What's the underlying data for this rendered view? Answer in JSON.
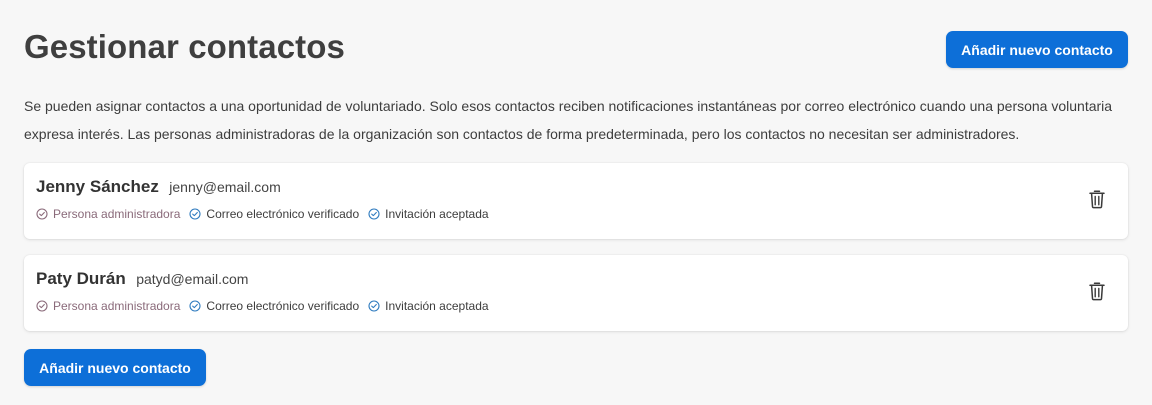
{
  "header": {
    "title": "Gestionar contactos",
    "add_button_label": "Añadir nuevo contacto"
  },
  "description": "Se pueden asignar contactos a una oportunidad de voluntariado. Solo esos contactos reciben notificaciones instantáneas por correo electrónico cuando una persona voluntaria expresa interés. Las personas administradoras de la organización son contactos de forma predeterminada, pero los contactos no necesitan ser administradores.",
  "contacts": [
    {
      "name": "Jenny Sánchez",
      "email": "jenny@email.com",
      "badges": [
        "Persona administradora",
        "Correo electrónico verificado",
        "Invitación aceptada"
      ]
    },
    {
      "name": "Paty Durán",
      "email": "patyd@email.com",
      "badges": [
        "Persona administradora",
        "Correo electrónico verificado",
        "Invitación aceptada"
      ]
    }
  ],
  "footer": {
    "add_button_label": "Añadir nuevo contacto"
  },
  "icons": {
    "badge": "check-circle-icon",
    "delete": "trash-icon"
  },
  "colors": {
    "primary": "#0d6fd8",
    "admin_badge": "#8a6a7a",
    "verified_icon": "#2f7bbf"
  }
}
